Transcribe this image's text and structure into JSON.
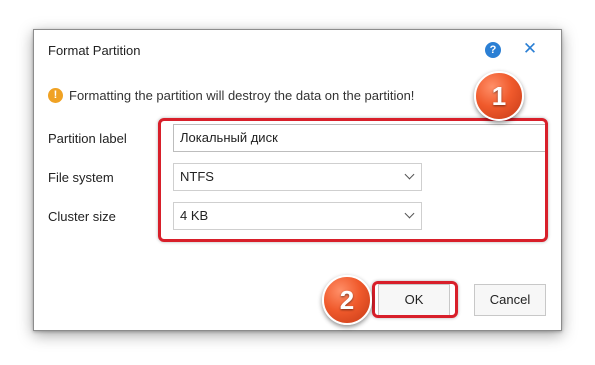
{
  "dialog": {
    "title": "Format Partition",
    "help_icon": "help-icon",
    "close_icon": "close-icon",
    "help_glyph": "?",
    "close_glyph": "✕"
  },
  "warning": {
    "icon": "warning-icon",
    "glyph": "!",
    "text": "Formatting the partition will destroy the data on the partition!"
  },
  "form": {
    "partition_label": {
      "label": "Partition label",
      "value": "Локальный диск"
    },
    "file_system": {
      "label": "File system",
      "value": "NTFS"
    },
    "cluster_size": {
      "label": "Cluster size",
      "value": "4 KB"
    }
  },
  "buttons": {
    "ok": "OK",
    "cancel": "Cancel"
  },
  "annotations": {
    "badge1": "1",
    "badge2": "2"
  },
  "colors": {
    "accent": "#2b7fd4",
    "warning": "#f0a224",
    "highlight": "#d81f2a",
    "badge": "#f05a2c"
  }
}
